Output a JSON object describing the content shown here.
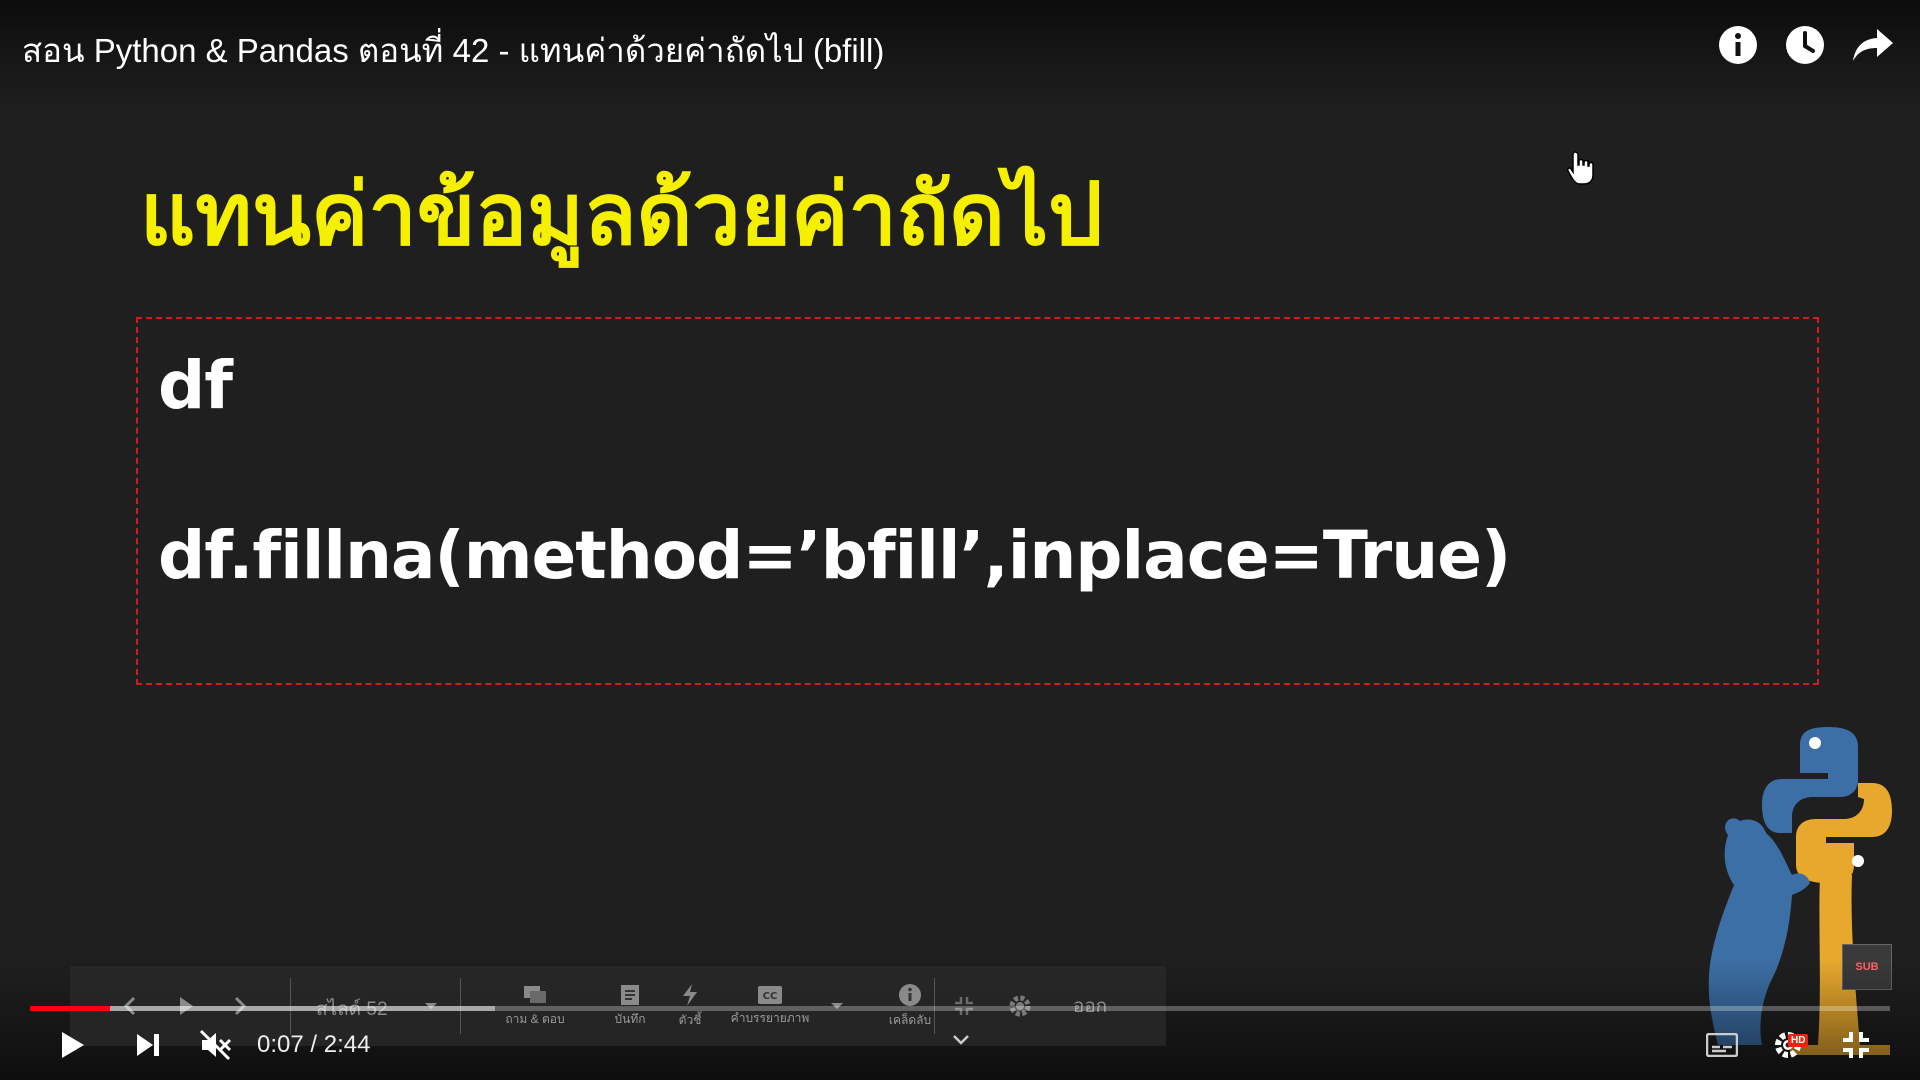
{
  "player": {
    "title": "สอน Python & Pandas ตอนที่ 42 - แทนค่าด้วยค่าถัดไป (bfill)",
    "time_current": "0:07",
    "time_separator": " / ",
    "time_total": "2:44",
    "progress_fraction": 0.043,
    "buffer_fraction": 0.25,
    "hd_badge": "HD",
    "sub_badge": "SUB",
    "icons": [
      "info-icon",
      "watch-later-icon",
      "share-icon",
      "play-icon",
      "next-icon",
      "mute-icon",
      "subtitles-icon",
      "settings-icon",
      "exit-fullscreen-icon"
    ]
  },
  "slide": {
    "heading": "แทนค่าข้อมูลด้วยค่าถัดไป",
    "code_line_1": "df",
    "code_line_2": "df.fillna(method=’bfill’,inplace=True)"
  },
  "toolbar": {
    "slide_label": "สไลด์ 52",
    "qa_label": "ถาม & ตอบ",
    "notes_label": "บันทึก",
    "pointer_label": "ตัวชี้",
    "captions_label": "คำบรรยายภาพ",
    "tips_label": "เคล็ดลับ",
    "exit_label": "ออก"
  },
  "colors": {
    "heading": "#f5f000",
    "progress": "#ff0000",
    "border": "#d01c1c",
    "background": "#1f1f1f"
  }
}
